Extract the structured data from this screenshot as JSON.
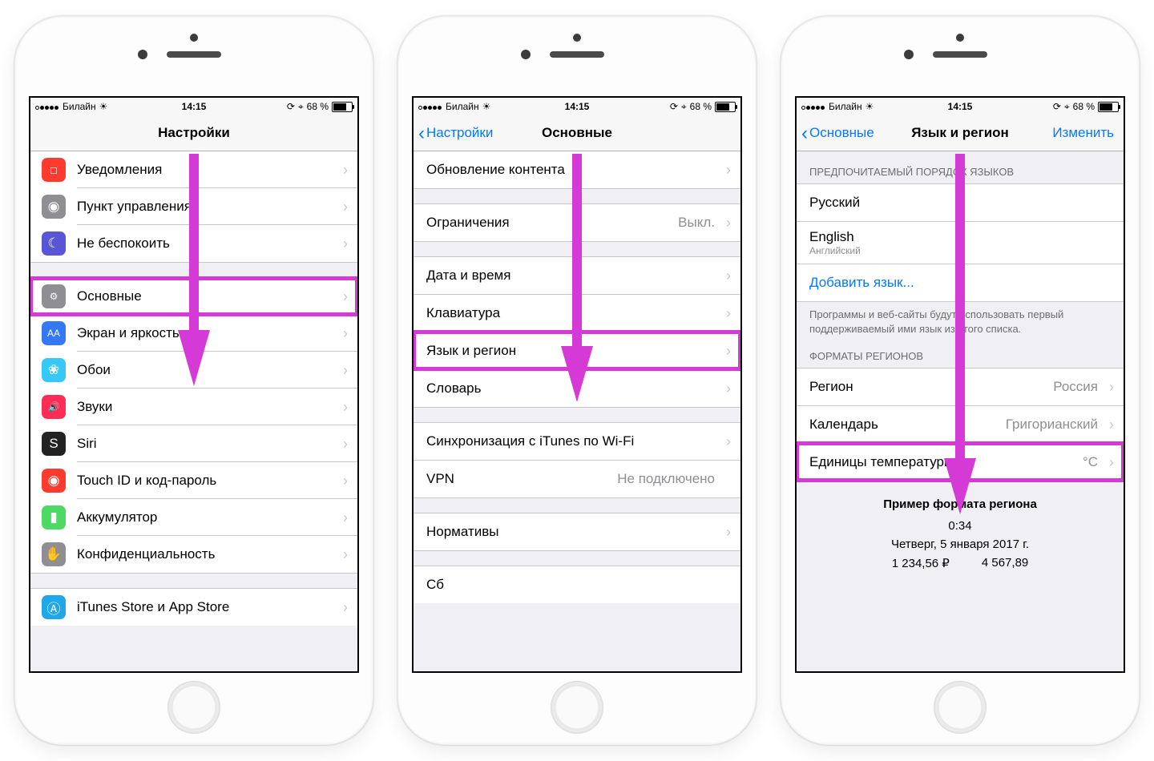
{
  "status": {
    "carrier": "Билайн",
    "time": "14:15",
    "battery": "68 %"
  },
  "phone1": {
    "title": "Настройки",
    "rows1": [
      {
        "icon_bg": "#ff3b30",
        "glyph": "◻︎",
        "label": "Уведомления"
      },
      {
        "icon_bg": "#8e8e93",
        "glyph": "◉",
        "label": "Пункт управления"
      },
      {
        "icon_bg": "#5856d6",
        "glyph": "☾",
        "label": "Не беспокоить"
      }
    ],
    "rows2": [
      {
        "icon_bg": "#8e8e93",
        "glyph": "⚙︎",
        "label": "Основные",
        "hl": true
      },
      {
        "icon_bg": "#3478f6",
        "glyph": "AA",
        "label": "Экран и яркость"
      },
      {
        "icon_bg": "#36c8f7",
        "glyph": "❀",
        "label": "Обои"
      },
      {
        "icon_bg": "#ff2d55",
        "glyph": "🔊",
        "label": "Звуки"
      },
      {
        "icon_bg": "#222",
        "glyph": "S",
        "label": "Siri"
      },
      {
        "icon_bg": "#ff3b30",
        "glyph": "◉",
        "label": "Touch ID и код-пароль"
      },
      {
        "icon_bg": "#4cd964",
        "glyph": "▮",
        "label": "Аккумулятор"
      },
      {
        "icon_bg": "#8e8e93",
        "glyph": "✋",
        "label": "Конфиденциальность"
      }
    ],
    "rows3": [
      {
        "icon_bg": "#1fa7e8",
        "glyph": "Ⓐ",
        "label": "iTunes Store и App Store"
      }
    ]
  },
  "phone2": {
    "back": "Настройки",
    "title": "Основные",
    "g1": [
      {
        "label": "Обновление контента"
      }
    ],
    "g2": [
      {
        "label": "Ограничения",
        "value": "Выкл."
      }
    ],
    "g3": [
      {
        "label": "Дата и время"
      },
      {
        "label": "Клавиатура"
      },
      {
        "label": "Язык и регион",
        "hl": true
      },
      {
        "label": "Словарь"
      }
    ],
    "g4": [
      {
        "label": "Синхронизация с iTunes по Wi-Fi"
      },
      {
        "label": "VPN",
        "value": "Не подключено",
        "nochev": false
      }
    ],
    "g5": [
      {
        "label": "Нормативы"
      }
    ],
    "g6_label_partial": "Сб"
  },
  "phone3": {
    "back": "Основные",
    "title": "Язык и регион",
    "action": "Изменить",
    "header1": "ПРЕДПОЧИТАЕМЫЙ ПОРЯДОК ЯЗЫКОВ",
    "langs": [
      {
        "label": "Русский"
      },
      {
        "label": "English",
        "sub": "Английский"
      }
    ],
    "add": "Добавить язык...",
    "footer1": "Программы и веб-сайты будут использовать первый поддерживаемый ими язык из этого списка.",
    "header2": "ФОРМАТЫ РЕГИОНОВ",
    "formats": [
      {
        "label": "Регион",
        "value": "Россия"
      },
      {
        "label": "Календарь",
        "value": "Григорианский"
      },
      {
        "label": "Единицы температуры",
        "value": "°C",
        "hl": true
      }
    ],
    "example": {
      "title": "Пример формата региона",
      "time": "0:34",
      "date": "Четверг, 5 января 2017 г.",
      "n1": "1 234,56 ₽",
      "n2": "4 567,89"
    }
  }
}
